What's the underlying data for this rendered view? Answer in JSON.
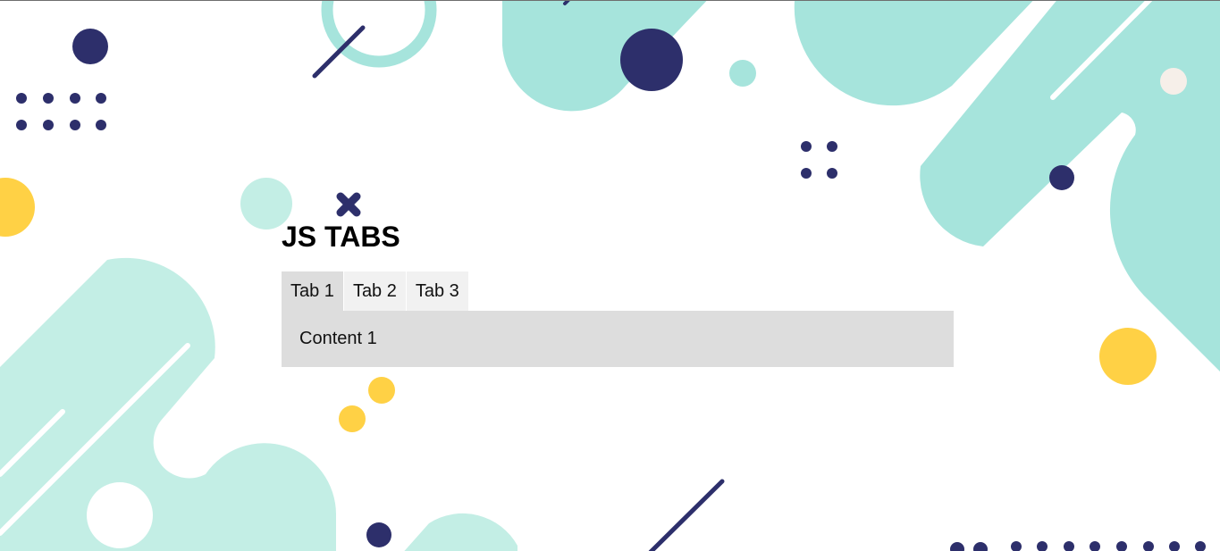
{
  "app": {
    "title": "JS TABS"
  },
  "tabs": [
    {
      "label": "Tab 1",
      "active": true
    },
    {
      "label": "Tab 2",
      "active": false
    },
    {
      "label": "Tab 3",
      "active": false
    }
  ],
  "panel": {
    "content": "Content 1"
  },
  "colors": {
    "teal_light": "#a6e4dc",
    "teal_pale": "#c3eee5",
    "navy": "#2d2f6b",
    "yellow": "#ffd145",
    "tab_bg": "#f1f1f1",
    "tab_active_bg": "#dddddd",
    "panel_bg": "#dddddd"
  }
}
